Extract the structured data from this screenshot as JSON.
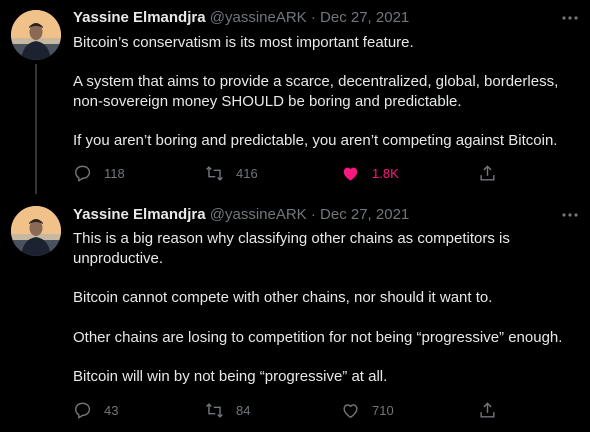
{
  "colors": {
    "background": "#000000",
    "text": "#e7e9ea",
    "secondary": "#71767b",
    "like_active": "#f91880"
  },
  "tweets": [
    {
      "author_name": "Yassine Elmandjra",
      "handle": "@yassineARK",
      "separator": "·",
      "date": "Dec 27, 2021",
      "paragraphs": [
        "Bitcoin’s conservatism is its most important feature.",
        "A system that aims to provide a scarce, decentralized, global, borderless,",
        "non-sovereign money SHOULD be boring and predictable.",
        "If you aren’t boring and predictable, you aren’t competing against Bitcoin."
      ],
      "replies": "118",
      "retweets": "416",
      "likes": "1.8K",
      "liked": true
    },
    {
      "author_name": "Yassine Elmandjra",
      "handle": "@yassineARK",
      "separator": "·",
      "date": "Dec 27, 2021",
      "paragraphs": [
        "This is a big reason why classifying other chains as competitors is",
        "unproductive.",
        "Bitcoin cannot compete with other chains, nor should it want to.",
        "Other chains are losing to competition for not being “progressive” enough.",
        "Bitcoin will win by not being “progressive” at all."
      ],
      "replies": "43",
      "retweets": "84",
      "likes": "710",
      "liked": false
    }
  ],
  "icons": [
    "avatar",
    "more-icon",
    "reply-icon",
    "retweet-icon",
    "like-icon",
    "share-icon"
  ]
}
